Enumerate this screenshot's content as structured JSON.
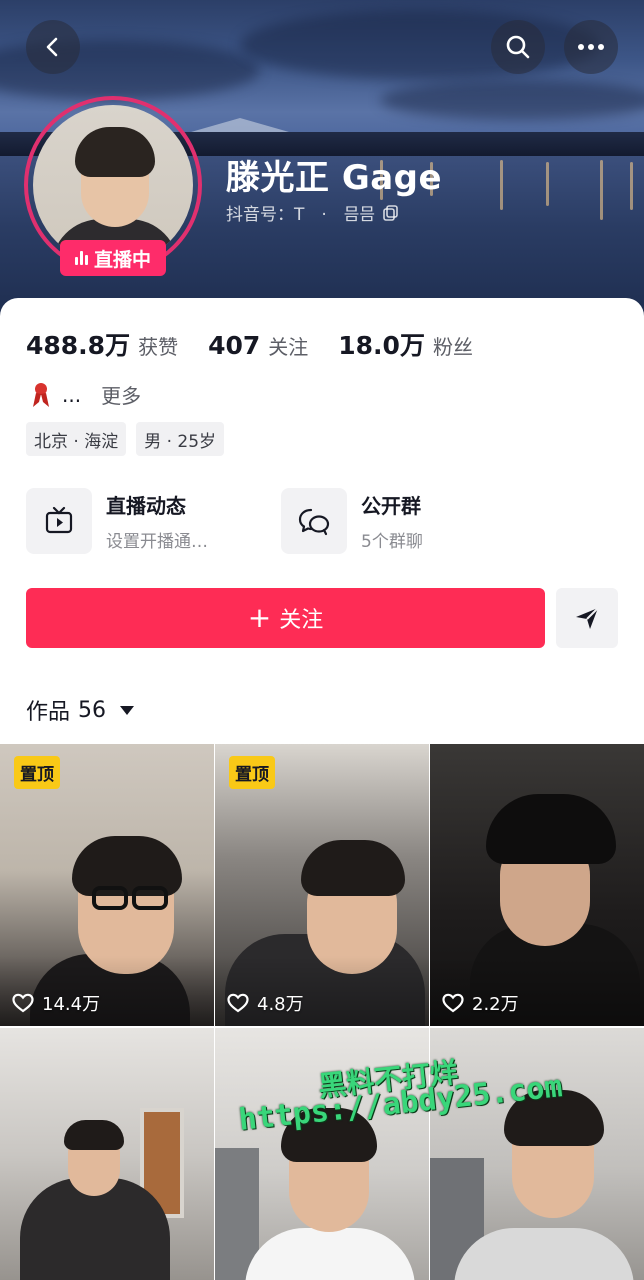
{
  "profile": {
    "name": "滕光正 Gage",
    "douyin_id_label": "抖音号：T　·　믐믐",
    "live_badge": "直播中"
  },
  "stats": [
    {
      "num": "488.8万",
      "label": "获赞"
    },
    {
      "num": "407",
      "label": "关注"
    },
    {
      "num": "18.0万",
      "label": "粉丝"
    }
  ],
  "bio": {
    "text": "...",
    "more": "更多"
  },
  "tags": [
    "北京 · 海淀",
    "男 · 25岁"
  ],
  "features": [
    {
      "title": "直播动态",
      "sub": "设置开播通…",
      "icon": "tv-icon"
    },
    {
      "title": "公开群",
      "sub": "5个群聊",
      "icon": "chat-icon"
    }
  ],
  "actions": {
    "follow": "关注",
    "follow_plus": "+"
  },
  "works": {
    "label": "作品",
    "count": "56"
  },
  "videos": [
    {
      "pinned": "置顶",
      "likes": "14.4万"
    },
    {
      "pinned": "置顶",
      "likes": "4.8万"
    },
    {
      "pinned": "",
      "likes": "2.2万"
    },
    {
      "pinned": "",
      "likes": ""
    },
    {
      "pinned": "",
      "likes": ""
    },
    {
      "pinned": "",
      "likes": ""
    }
  ],
  "watermark": {
    "line1": "黑料不打烊",
    "line2": "https://abdy25.com"
  },
  "colors": {
    "accent": "#fe2c55",
    "live": "#fe2c6a",
    "pin": "#f9c917"
  }
}
